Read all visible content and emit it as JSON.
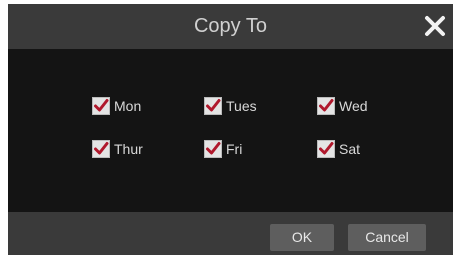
{
  "dialog": {
    "title": "Copy To",
    "close_icon": "close-icon"
  },
  "days": [
    {
      "label": "Mon",
      "checked": true
    },
    {
      "label": "Tues",
      "checked": true
    },
    {
      "label": "Wed",
      "checked": true
    },
    {
      "label": "Thur",
      "checked": true
    },
    {
      "label": "Fri",
      "checked": true
    },
    {
      "label": "Sat",
      "checked": true
    }
  ],
  "buttons": {
    "ok_label": "OK",
    "cancel_label": "Cancel"
  },
  "colors": {
    "check_mark": "#b0182c",
    "titlebar": "#3a3a3a",
    "body": "#141414"
  }
}
